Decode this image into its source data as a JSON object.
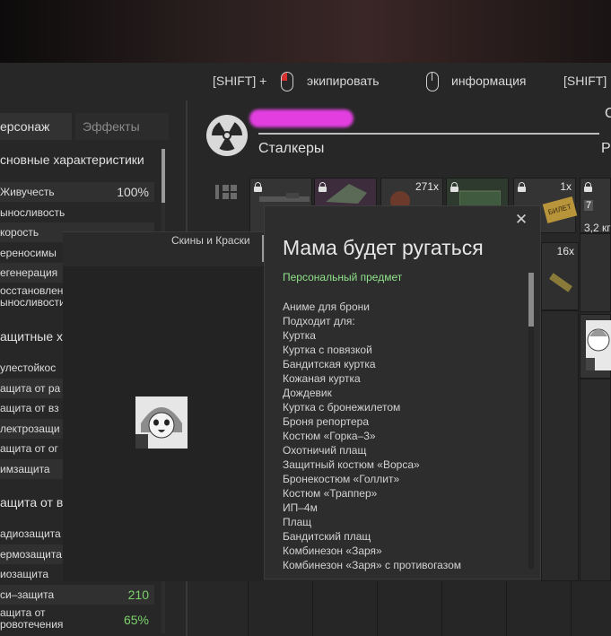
{
  "hints": {
    "shift_equip": "[SHIFT] +",
    "equip_label": "экипировать",
    "info_label": "информация",
    "shift_right": "[SHIFT]"
  },
  "left_panel": {
    "tabs": [
      "ерсонаж",
      "Эффекты"
    ],
    "section_main": "сновные характеристики",
    "rows_main": [
      {
        "label": "Живучесть",
        "value": "100%"
      },
      {
        "label": "ыносливость",
        "value": ""
      },
      {
        "label": "корость",
        "value": ""
      },
      {
        "label": "ереносимы",
        "value": ""
      },
      {
        "label": "егенерация",
        "value": ""
      },
      {
        "label": "осстановлен ыносливости",
        "value": ""
      }
    ],
    "section_protect": "ащитные ха",
    "rows_protect": [
      {
        "label": "улестойкос",
        "value": ""
      },
      {
        "label": "ащита от ра",
        "value": ""
      },
      {
        "label": "ащита от вз",
        "value": ""
      },
      {
        "label": "лектрозащи",
        "value": ""
      },
      {
        "label": "ащита от ог",
        "value": ""
      },
      {
        "label": "имзащита",
        "value": ""
      }
    ],
    "section_env": "ащита от в",
    "rows_env": [
      {
        "label": "адиозащита",
        "value": ""
      },
      {
        "label": "ермозащита",
        "value": ""
      },
      {
        "label": "иозащита",
        "value": ""
      },
      {
        "label": "си–защита",
        "value": "210"
      },
      {
        "label": "ащита от ровотечения",
        "value": "65%"
      }
    ]
  },
  "header": {
    "group": "Сталкеры",
    "right_r": "Р",
    "right_c": "С"
  },
  "inventory": {
    "counts": [
      "271x",
      "1x",
      "16x",
      "3,2 кг",
      "7"
    ],
    "ticket_label": "БИЛЕТ"
  },
  "skins": {
    "title": "Скины и Краски"
  },
  "tooltip": {
    "close": "✕",
    "title": "Мама будет ругаться",
    "subtitle": "Персональный предмет",
    "lines": [
      "Аниме для брони",
      "Подходит для:",
      "Куртка",
      "Куртка с повязкой",
      "Бандитская куртка",
      "Кожаная куртка",
      "Дождевик",
      "Куртка с бронежилетом",
      "Броня репортера",
      "Костюм «Горка–3»",
      "Охотничий плащ",
      "Защитный костюм «Ворса»",
      "Бронекостюм «Голлит»",
      "Костюм «Траппер»",
      "ИП–4м",
      "Плащ",
      "Бандитский плащ",
      "Комбинезон «Заря»",
      "Комбинезон «Заря» с противогазом"
    ]
  },
  "colors": {
    "accent_green": "#8fe28a",
    "value_green": "#7bd16b",
    "redacted_magenta": "#e33fe0"
  }
}
